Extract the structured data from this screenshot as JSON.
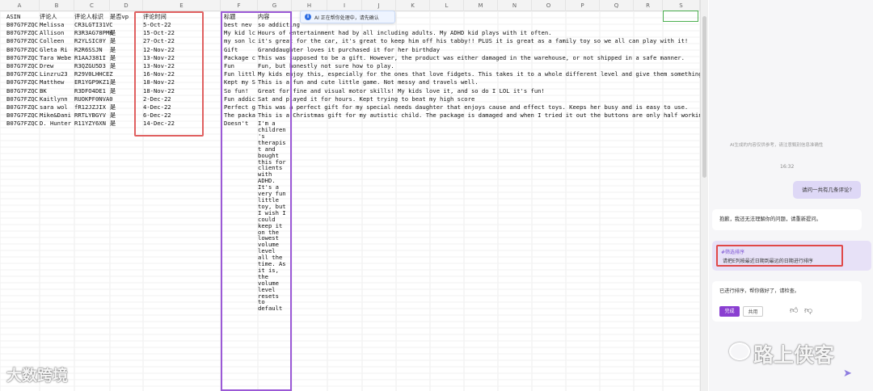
{
  "columns": [
    "A",
    "B",
    "C",
    "D",
    "E",
    "F",
    "G",
    "H",
    "I",
    "J",
    "K",
    "L",
    "M",
    "N",
    "O",
    "P",
    "Q",
    "R",
    "S"
  ],
  "headers": {
    "asin": "ASIN",
    "reviewer": "评论人",
    "reviewer_id": "评论人标识",
    "vp": "是否vp",
    "date": "评论时间",
    "title": "标题",
    "content": "内容"
  },
  "rows": [
    {
      "asin": "B07G7FZQC",
      "reviewer": "Melissa",
      "rid": "CR3LGTI31VCZH19",
      "vp": "",
      "date": "5-Oct-22",
      "title": "best nev",
      "content": "so addicting"
    },
    {
      "asin": "B07G7FZQC",
      "reviewer": "Allison",
      "rid": "R3R3AG78PMK",
      "vp": "是",
      "date": "15-Oct-22",
      "title": "My kid lc",
      "content": "Hours of entertainment had by all including adults. My ADHD kid plays with it often."
    },
    {
      "asin": "B07G7FZQC",
      "reviewer": "Colleen",
      "rid": "R2YLSIC0Y",
      "vp": "是",
      "date": "27-Oct-22",
      "title": "my son lc",
      "content": "it's great for the car, it's great to keep him off his tabby!! PLUS it is great as a family toy so we all can play with it!"
    },
    {
      "asin": "B07G7FZQC",
      "reviewer": "Gleta Ri",
      "rid": "R2R6SSJN",
      "vp": "是",
      "date": "12-Nov-22",
      "title": "Gift",
      "content": "Granddaughter loves it purchased it for her birthday"
    },
    {
      "asin": "B07G7FZQC",
      "reviewer": "Tara Webe",
      "rid": "R1AAJ381I",
      "vp": "是",
      "date": "13-Nov-22",
      "title": "Package c",
      "content": "This was supposed to be a gift. However, the product was either damaged in the warehouse, or not shipped in a safe manner."
    },
    {
      "asin": "B07G7FZQC",
      "reviewer": "Drew",
      "rid": "R3QZGU5D3",
      "vp": "是",
      "date": "13-Nov-22",
      "title": "Fun",
      "content": "Fun, but honestly not sure how to play."
    },
    {
      "asin": "B07G7FZQC",
      "reviewer": "Linzru23",
      "rid": "R29V0LHHCEZGD",
      "vp": "",
      "date": "16-Nov-22",
      "title": "Fun littl",
      "content": "My kids enjoy this, especially for the ones that love fidgets. This takes it to a whole different level and give them something to do."
    },
    {
      "asin": "B07G7FZQC",
      "reviewer": "Matthew",
      "rid": "ER1YGP9KZ1",
      "vp": "是",
      "date": "18-Nov-22",
      "title": "Kept my S",
      "content": "This is a fun and cute little game. Not messy and travels well."
    },
    {
      "asin": "B07G7FZQC",
      "reviewer": "BK",
      "rid": "R3DFO4DE1",
      "vp": "是",
      "date": "18-Nov-22",
      "title": "So fun!",
      "content": "Great for fine and visual motor skills! My kids love it, and so do I LOL it's fun!"
    },
    {
      "asin": "B07G7FZQC",
      "reviewer": "Kaitlynn",
      "rid": "RUOKPF0NVA0DX",
      "vp": "",
      "date": "2-Dec-22",
      "title": "Fun addic",
      "content": "Sat and played it for hours. Kept trying to beat my high score"
    },
    {
      "asin": "B07G7FZQC",
      "reviewer": "sara wol",
      "rid": "fR12JZJIX",
      "vp": "是",
      "date": "4-Dec-22",
      "title": "Perfect g",
      "content": "This was a perfect gift for my special needs daughter that enjoys cause and effect toys. Keeps her busy and is easy to use."
    },
    {
      "asin": "B07G7FZQC",
      "reviewer": "Mike&Dani",
      "rid": "RRTLYBGYV",
      "vp": "是",
      "date": "6-Dec-22",
      "title": "The packa",
      "content": "This is a Christmas gift for my autistic child. The package is damaged and when I tried it out the buttons are only half working."
    },
    {
      "asin": "B07G7FZQC",
      "reviewer": "D. Hunter",
      "rid": "R11YZY6XN",
      "vp": "是",
      "date": "14-Dec-22",
      "title": "Doesn't",
      "content": "I'm a"
    }
  ],
  "wrapped_text": [
    "children",
    "'s",
    "therapis",
    "t and",
    "bought",
    "this for",
    "clients",
    "with",
    "ADHD.",
    "It's a",
    "very fun",
    "little",
    "toy, but",
    "I wish I",
    "could",
    "keep it",
    "on the",
    "lowest",
    "volume",
    "level",
    "all the",
    "time. As",
    "it is,",
    "the",
    "volume",
    "level",
    "resets",
    "to",
    "default"
  ],
  "ai_toast": "AI 正在帮你处理中，请先确认",
  "chat": {
    "disclaimer": "AI生成的内容仅供参考，请注意甄别信息准确性",
    "timestamp": "16:32",
    "user_question": "请问一共有几条评论?",
    "ai_reply_1": "抱歉，我还无法理解你的问题，请重新提问。",
    "command_tag": "#筛选排序",
    "command_text": "请把E列按最近日期到最远的日期进行排序",
    "done_text": "已进行排序，帮你做好了，请检查。",
    "done_button": "完成",
    "share_button": "共用"
  },
  "watermarks": {
    "left": "大数跨境",
    "right": "路上侠客"
  },
  "colors": {
    "accent_purple": "#8a3fd1",
    "highlight_red": "#e06060",
    "column_purple": "#9b59d6"
  }
}
